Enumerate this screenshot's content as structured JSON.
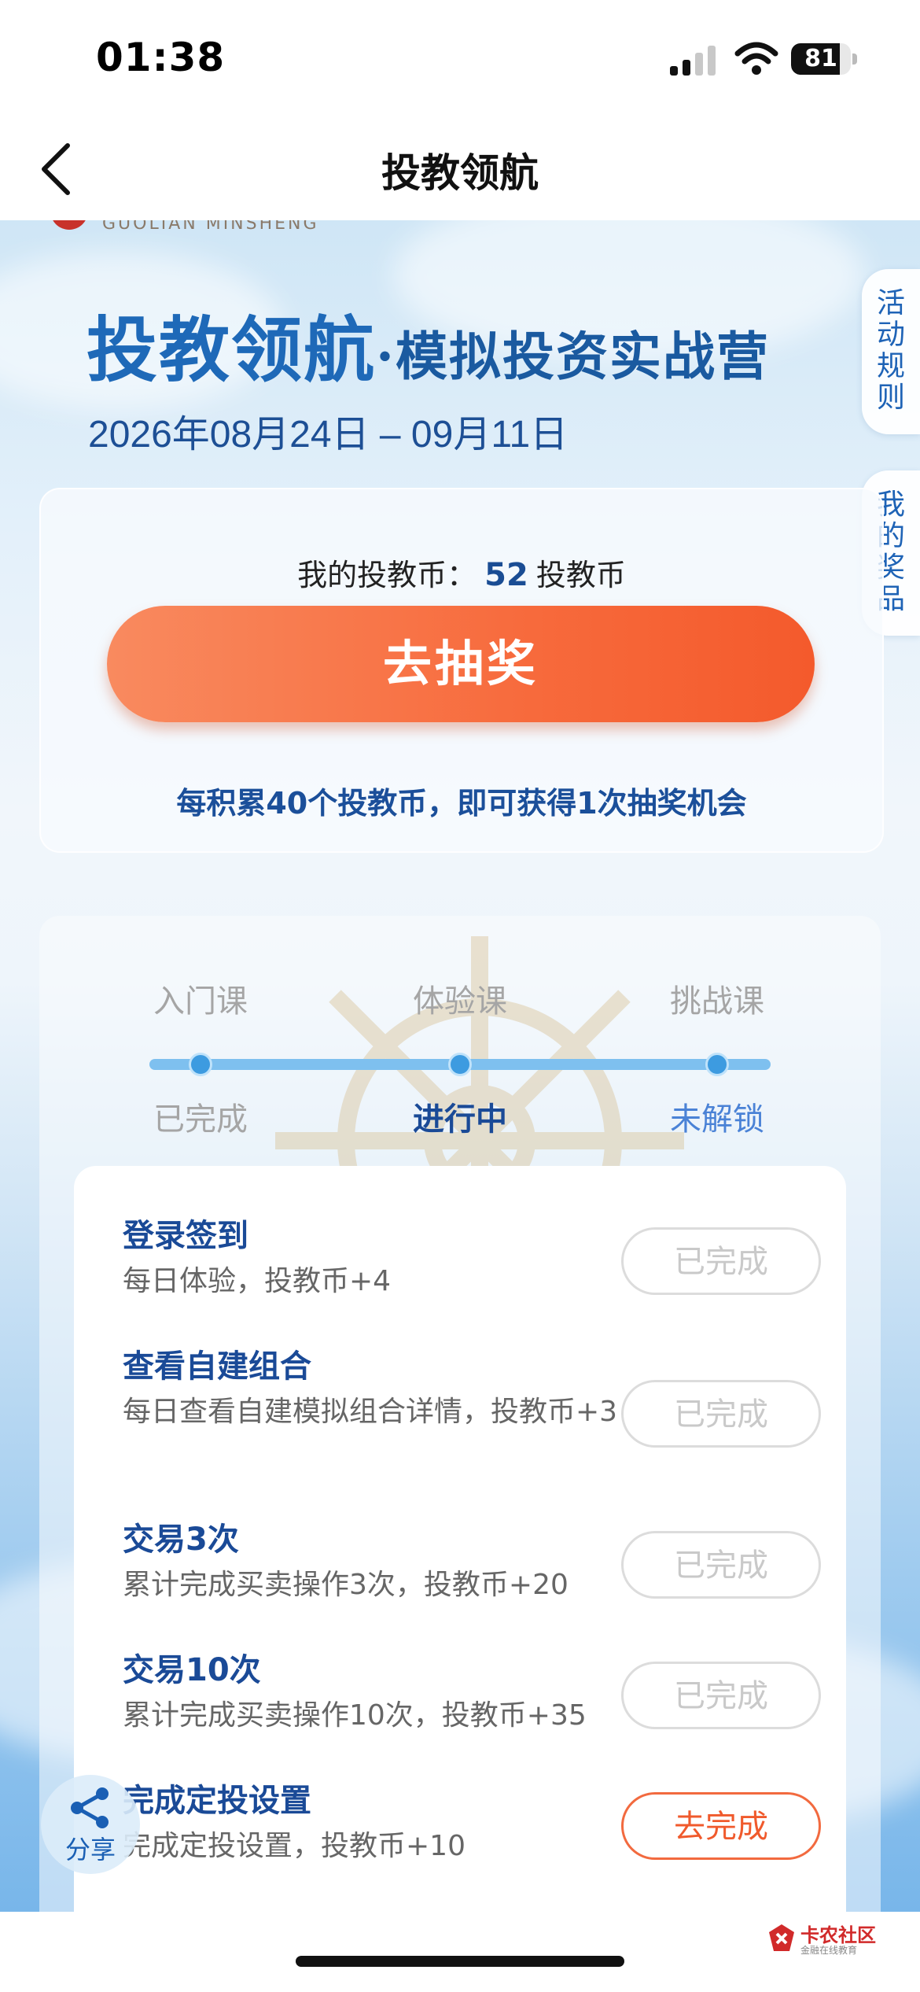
{
  "status_bar": {
    "time": "01:38",
    "battery": "81",
    "battery_level": 0.81
  },
  "nav": {
    "title": "投教领航"
  },
  "hero": {
    "brand_sub": "GUOLIAN MINSHENG",
    "title_main": "投教领航",
    "title_sub": "·模拟投资实战营",
    "date": "2026年08月24日 – 09月11日"
  },
  "side_tabs": {
    "rules": "活动规则",
    "prizes": "我的奖品"
  },
  "coins": {
    "label": "我的投教币：",
    "value": "52",
    "unit": "投教币",
    "draw_button": "去抽奖",
    "tip": "每积累40个投教币，即可获得1次抽奖机会"
  },
  "stages": [
    {
      "label": "入门课",
      "status": "已完成",
      "status_color": "#a5a5a5"
    },
    {
      "label": "体验课",
      "status": "进行中",
      "status_color": "#1a4a97"
    },
    {
      "label": "挑战课",
      "status": "未解锁",
      "status_color": "#4a82d6"
    }
  ],
  "tasks": [
    {
      "title": "登录签到",
      "desc": "每日体验，投教币+4",
      "button": "已完成"
    },
    {
      "title": "查看自建组合",
      "desc": "每日查看自建模拟组合详情，投教币+3",
      "button": "已完成"
    },
    {
      "title": "交易3次",
      "desc": "累计完成买卖操作3次，投教币+20",
      "button": "已完成"
    },
    {
      "title": "交易10次",
      "desc": "累计完成买卖操作10次，投教币+35",
      "button": "已完成"
    },
    {
      "title": "完成定投设置",
      "desc": "完成定投设置，投教币+10",
      "button": "去完成"
    }
  ],
  "share": {
    "label": "分享"
  },
  "watermark": {
    "title": "卡农社区",
    "sub": "金融在线教育"
  }
}
